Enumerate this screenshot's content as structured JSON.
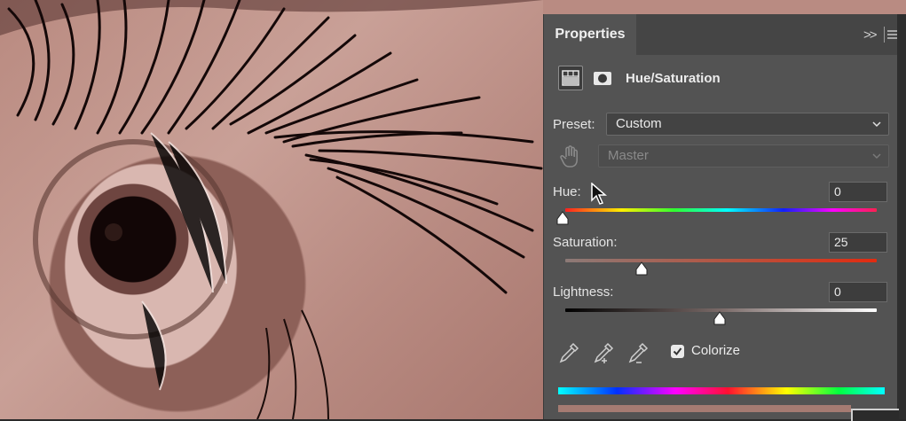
{
  "panel": {
    "tab_label": "Properties",
    "adjustment_title": "Hue/Saturation",
    "preset": {
      "label": "Preset:",
      "value": "Custom"
    },
    "channel": {
      "value": "Master",
      "disabled": true
    },
    "hue": {
      "label": "Hue:",
      "value": "0"
    },
    "saturation": {
      "label": "Saturation:",
      "value": "25"
    },
    "lightness": {
      "label": "Lightness:",
      "value": "0"
    },
    "colorize": {
      "label": "Colorize",
      "checked": true
    }
  },
  "icons": {
    "tab_collapse": "double-chevron-right-icon",
    "tab_menu": "hamburger-menu-icon",
    "adjustment": "hue-saturation-adjustment-icon",
    "mask": "layer-mask-icon",
    "targeted_adjust": "hand-pointer-icon",
    "eyedropper": "eyedropper-icon",
    "eyedropper_add": "eyedropper-plus-icon",
    "eyedropper_subtract": "eyedropper-minus-icon"
  },
  "colors": {
    "panel_bg": "#535353",
    "tab_bar_bg": "#454545",
    "photo_tint": "#b98a80"
  }
}
